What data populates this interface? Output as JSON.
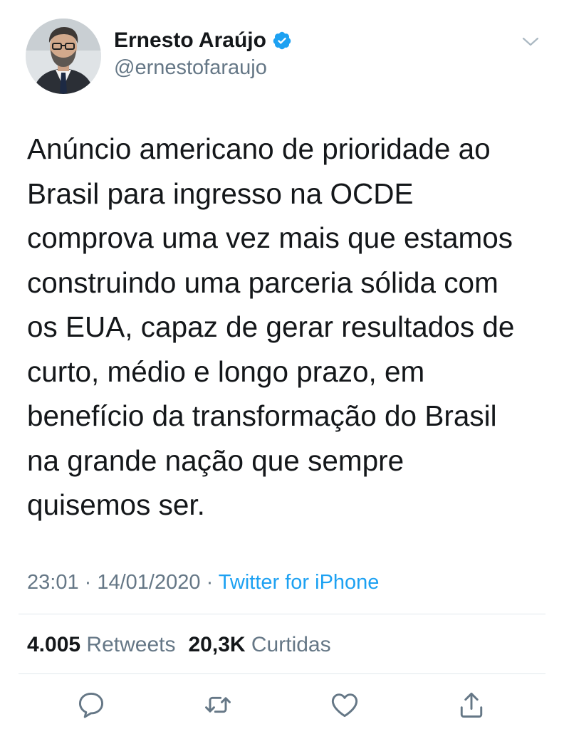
{
  "author": {
    "display_name": "Ernesto Araújo",
    "handle": "@ernestofaraujo",
    "verified": true,
    "avatar_icon": "profile-photo"
  },
  "tweet": {
    "text": "Anúncio americano de prioridade ao\nBrasil para ingresso na OCDE\ncomprova uma vez mais que estamos\nconstruindo uma parceria sólida com\nos EUA, capaz de gerar resultados de\ncurto, médio e longo prazo, em\nbenefício da transformação do Brasil\nna grande nação que sempre\nquisemos ser."
  },
  "meta": {
    "time": "23:01",
    "separator": " · ",
    "date": "14/01/2020",
    "source": "Twitter for iPhone"
  },
  "stats": {
    "retweets_count": "4.005",
    "retweets_label": "Retweets",
    "likes_count": "20,3K",
    "likes_label": "Curtidas"
  },
  "actions": {
    "icons": [
      "reply-icon",
      "retweet-icon",
      "like-icon",
      "share-icon"
    ]
  },
  "colors": {
    "accent": "#1da1f2",
    "text": "#14171a",
    "secondary": "#657786",
    "divider": "#e1e8ed",
    "icon": "#657786"
  }
}
